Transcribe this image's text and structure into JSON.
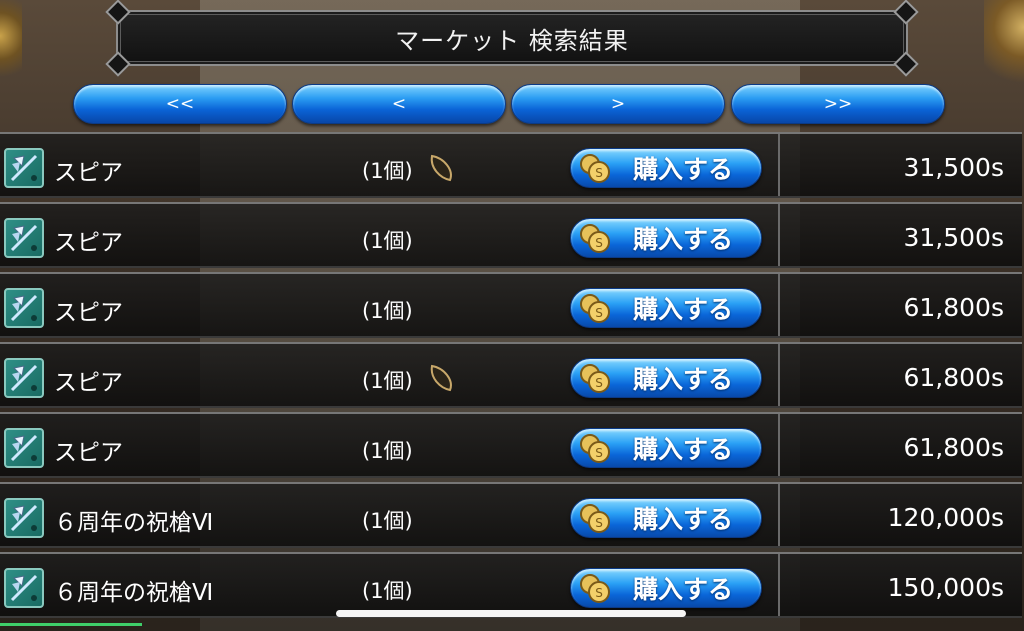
{
  "header": {
    "title": "マーケット 検索結果"
  },
  "nav": {
    "first": "<<",
    "prev": "<",
    "next": ">",
    "last": ">>"
  },
  "buy_label": "購入する",
  "rows": [
    {
      "name": "スピア",
      "qty": "(1個)",
      "price": "31,500s",
      "seed": true
    },
    {
      "name": "スピア",
      "qty": "(1個)",
      "price": "31,500s",
      "seed": false
    },
    {
      "name": "スピア",
      "qty": "(1個)",
      "price": "61,800s",
      "seed": false
    },
    {
      "name": "スピア",
      "qty": "(1個)",
      "price": "61,800s",
      "seed": true
    },
    {
      "name": "スピア",
      "qty": "(1個)",
      "price": "61,800s",
      "seed": false
    },
    {
      "name": "６周年の祝槍Ⅵ",
      "qty": "(1個)",
      "price": "120,000s",
      "seed": false
    },
    {
      "name": "６周年の祝槍Ⅵ",
      "qty": "(1個)",
      "price": "150,000s",
      "seed": false
    }
  ],
  "icons": {
    "item": "spear-axe-icon",
    "seed": "seed-icon",
    "coin": "coin-icon"
  },
  "colors": {
    "button_blue": "#0a63d6",
    "row_bg": "#141414",
    "icon_teal": "#2f8f86"
  }
}
